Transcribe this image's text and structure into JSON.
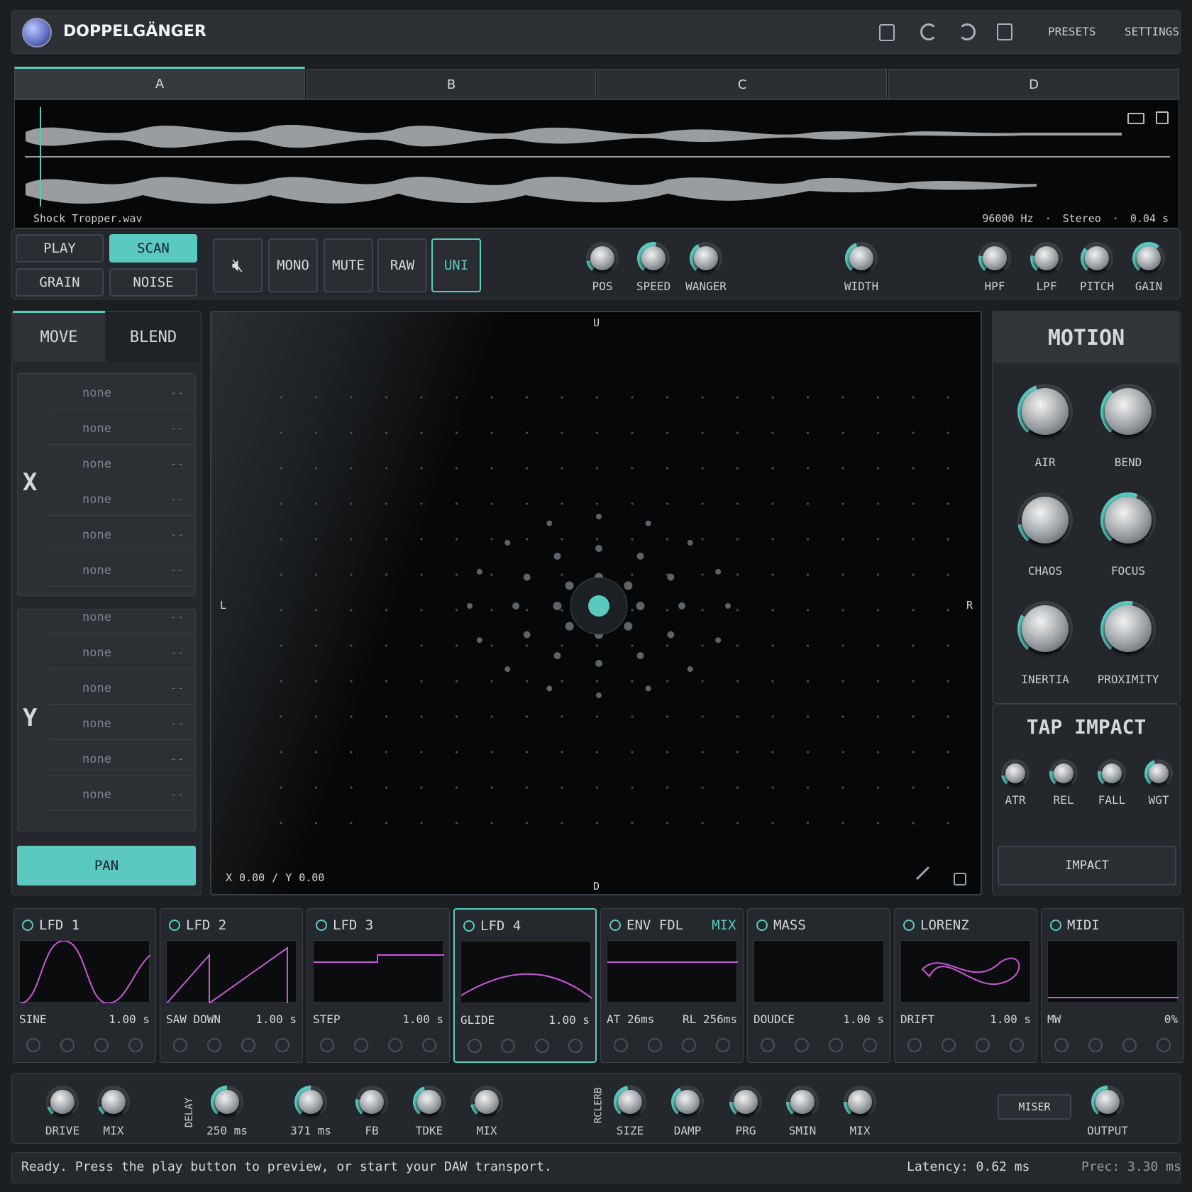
{
  "app": {
    "title": "DOPPELGÄNGER",
    "presets": "PRESETS",
    "settings": "SETTINGS"
  },
  "tabs": [
    "A",
    "B",
    "C",
    "D"
  ],
  "sample": {
    "name": "Shock Tropper.wav",
    "rate": "96000 Hz",
    "channels": "Stereo",
    "length": "0.04 s"
  },
  "modes": {
    "play": "PLAY",
    "scan": "SCAN",
    "grain": "GRAIN",
    "noise": "NOISE"
  },
  "toggles": {
    "mono": "MONO",
    "mute": "MUTE",
    "raw": "RAW",
    "uni": "UNI"
  },
  "topknobs": [
    "POS",
    "SPEED",
    "WANGER",
    "WIDTH",
    "HPF",
    "LPF",
    "PITCH",
    "GAIN"
  ],
  "routing": {
    "move": "MOVE",
    "blend": "BLEND",
    "x": "X",
    "y": "Y",
    "none": "none",
    "dash": "--",
    "pan": "PAN"
  },
  "pad": {
    "u": "U",
    "d": "D",
    "l": "L",
    "r": "R",
    "coord_x_label": "X",
    "x": "0.00",
    "sep": "/",
    "coord_y_label": "Y",
    "y": "0.00"
  },
  "motion": {
    "title": "MOTION",
    "knobs": [
      "AIR",
      "BEND",
      "CHAOS",
      "FOCUS",
      "INERTIA",
      "PROXIMITY"
    ]
  },
  "tap": {
    "title": "TAP IMPACT",
    "knobs": [
      "ATR",
      "REL",
      "FALL",
      "WGT"
    ],
    "impact": "IMPACT"
  },
  "mods": [
    {
      "title": "LFD 1",
      "wave": "SINE",
      "time": "1.00 s"
    },
    {
      "title": "LFD 2",
      "wave": "SAW DOWN",
      "time": "1.00 s"
    },
    {
      "title": "LFD 3",
      "wave": "STEP",
      "time": "1.00 s"
    },
    {
      "title": "LFD 4",
      "wave": "GLIDE",
      "time": "1.00 s"
    },
    {
      "title": "ENV FDL",
      "extra": "MIX",
      "wave": "AT 26ms",
      "time": "RL 256ms"
    },
    {
      "title": "MASS",
      "wave": "DOUDCE",
      "time": "1.00 s"
    },
    {
      "title": "LORENZ",
      "wave": "DRIFT",
      "time": "1.00 s"
    },
    {
      "title": "MIDI",
      "wave": "MW",
      "time": "0%"
    }
  ],
  "fx": {
    "drive": "DRIVE",
    "mix": "MIX",
    "delay": "DELAY",
    "d1": "250 ms",
    "d2": "371 ms",
    "fb": "FB",
    "tdke": "TDKE",
    "mix2": "MIX",
    "reverb": "RCLERB",
    "size": "SIZE",
    "damp": "DAMP",
    "prg": "PRG",
    "smin": "SMIN",
    "mix3": "MIX",
    "miser": "MISER",
    "output": "OUTPUT"
  },
  "status": {
    "message": "Ready. Press the play button to preview, or start your DAW transport.",
    "latency": "Latency: 0.62 ms",
    "prec": "Prec: 3.30 ms"
  },
  "colors": {
    "accent": "#5cc9c0",
    "mod_line": "#c65ad6"
  }
}
